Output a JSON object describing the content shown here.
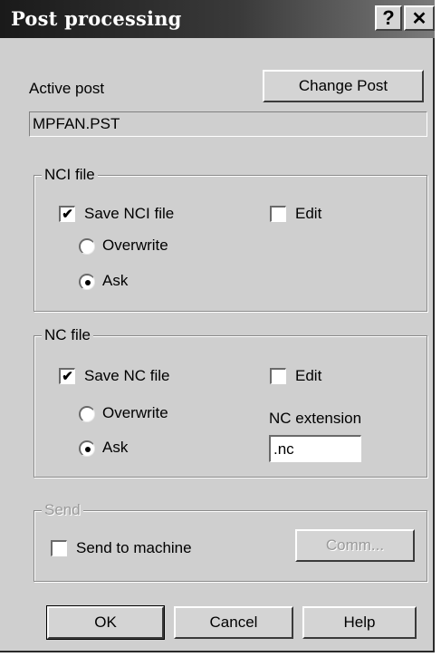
{
  "window": {
    "title": "Post processing",
    "help_glyph": "?",
    "close_glyph": "✕"
  },
  "active_post": {
    "label": "Active post",
    "change_button": "Change Post",
    "value": "MPFAN.PST"
  },
  "nci_file": {
    "group_title": "NCI file",
    "save_label": "Save NCI file",
    "save_checked": true,
    "edit_label": "Edit",
    "edit_checked": false,
    "overwrite_label": "Overwrite",
    "ask_label": "Ask",
    "selected_option": "Ask"
  },
  "nc_file": {
    "group_title": "NC file",
    "save_label": "Save NC file",
    "save_checked": true,
    "edit_label": "Edit",
    "edit_checked": false,
    "overwrite_label": "Overwrite",
    "ask_label": "Ask",
    "selected_option": "Ask",
    "extension_label": "NC extension",
    "extension_value": ".nc"
  },
  "send": {
    "group_title": "Send",
    "send_label": "Send to machine",
    "send_checked": false,
    "comm_button": "Comm..."
  },
  "footer": {
    "ok": "OK",
    "cancel": "Cancel",
    "help": "Help"
  }
}
